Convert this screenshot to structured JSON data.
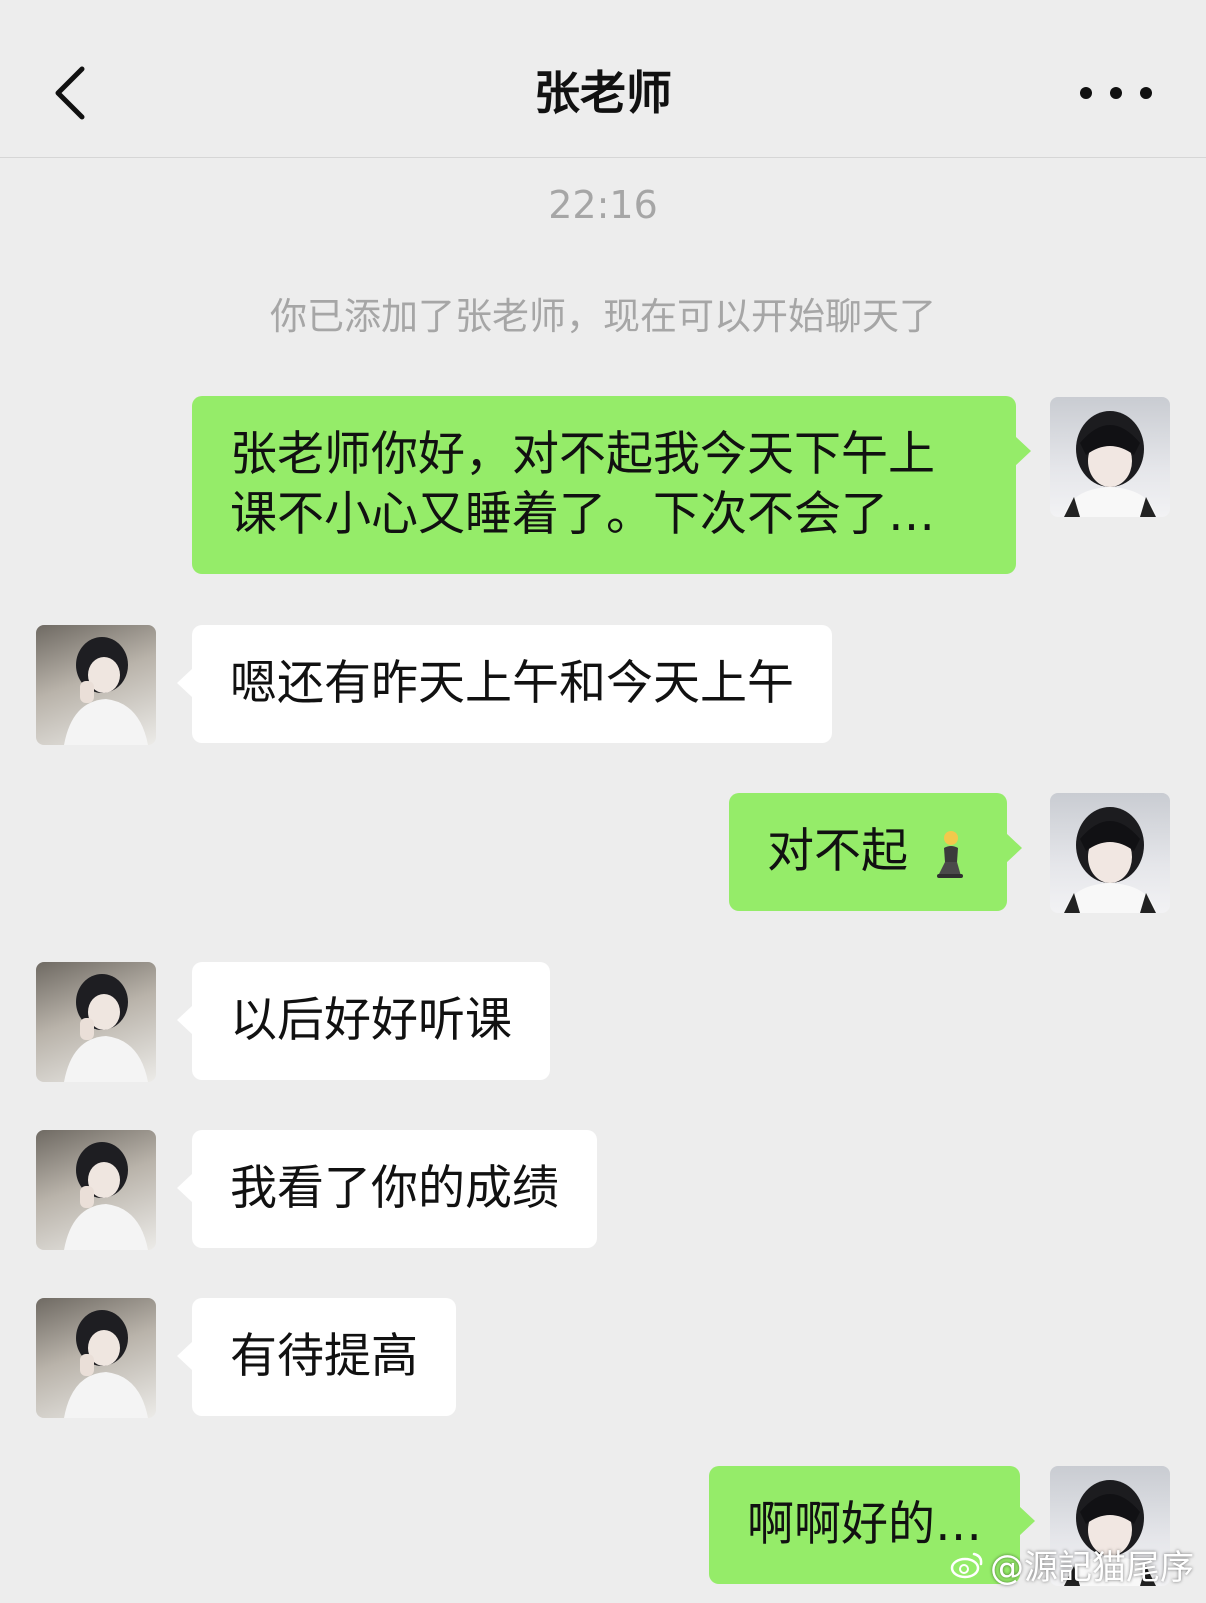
{
  "header": {
    "title": "张老师"
  },
  "chat": {
    "timestamp": "22:16",
    "system_notice": "你已添加了张老师，现在可以开始聊天了",
    "messages": [
      {
        "from": "me",
        "text": "张老师你好，对不起我今天下午上课不小心又睡着了。下次不会了…"
      },
      {
        "from": "teacher",
        "text": "嗯还有昨天上午和今天上午"
      },
      {
        "from": "me",
        "text": "对不起"
      },
      {
        "from": "teacher",
        "text": "以后好好听课"
      },
      {
        "from": "teacher",
        "text": "我看了你的成绩"
      },
      {
        "from": "teacher",
        "text": "有待提高"
      },
      {
        "from": "me",
        "text": "啊啊好的…"
      }
    ]
  },
  "watermark": {
    "text": "@源記猫尾序"
  },
  "icons": {
    "back": "chevron-left-icon",
    "more": "more-dots-icon",
    "kneeling_emoji": "kneeling-person-icon",
    "weibo": "weibo-logo-icon"
  },
  "colors": {
    "background": "#ededed",
    "my_bubble": "#95ec69",
    "teacher_bubble": "#ffffff",
    "muted_text": "#a6a6a6"
  }
}
